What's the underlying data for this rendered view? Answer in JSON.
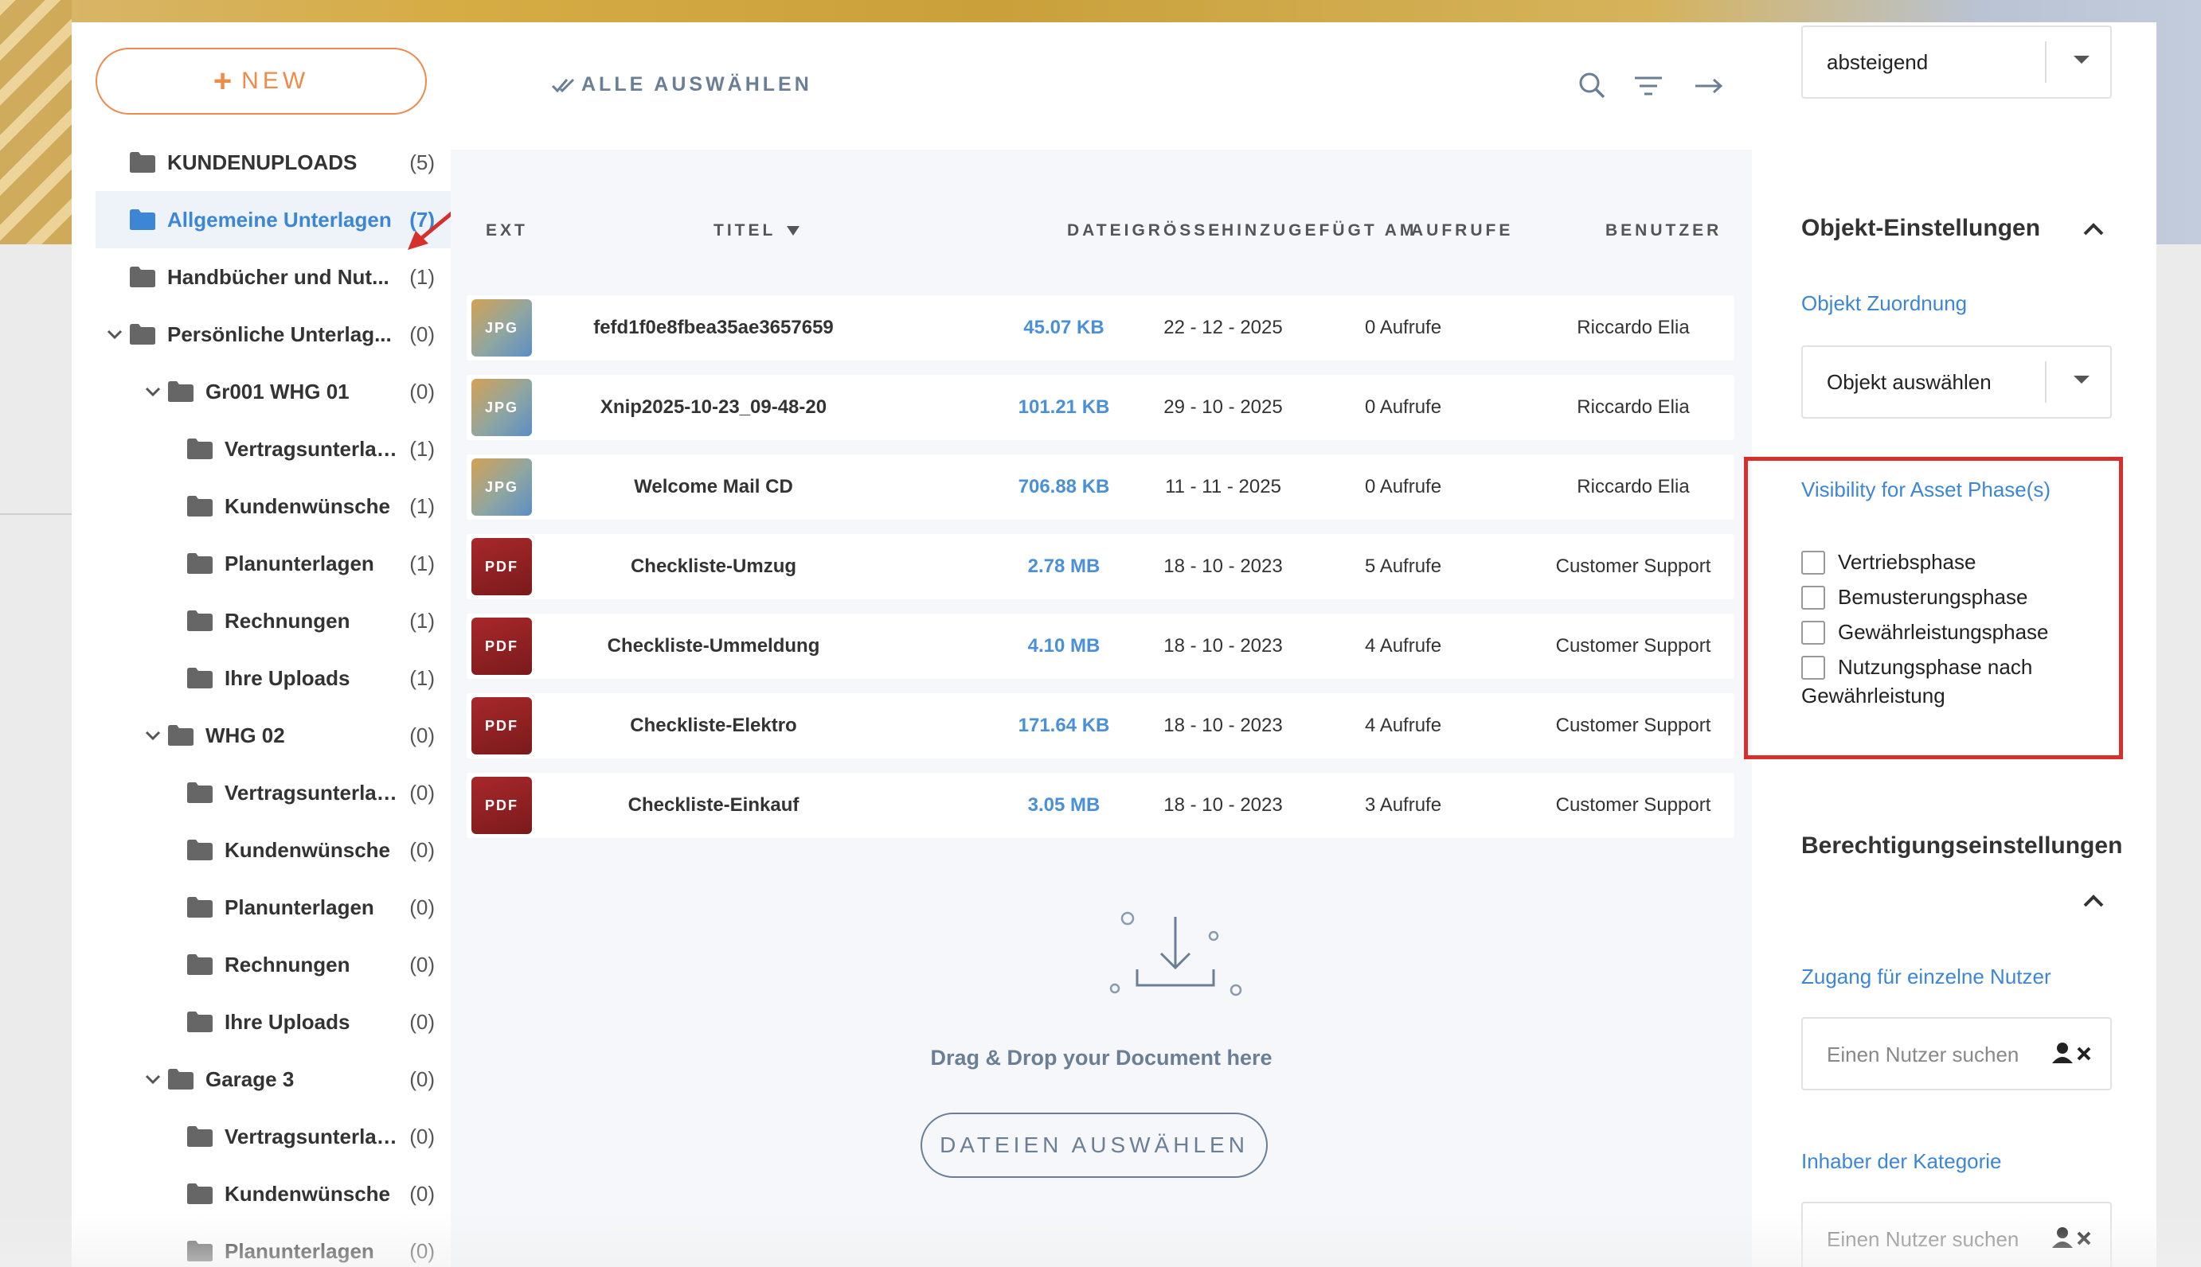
{
  "sidebar": {
    "new_label": "NEW",
    "items": [
      {
        "label": "KUNDENUPLOADS",
        "count": "(5)"
      },
      {
        "label": "Allgemeine Unterlagen",
        "count": "(7)"
      },
      {
        "label": "Handbücher und Nut...",
        "count": "(1)"
      },
      {
        "label": "Persönliche Unterlag...",
        "count": "(0)"
      },
      {
        "label": "Gr001 WHG 01",
        "count": "(0)"
      },
      {
        "label": "Vertragsunterlag...",
        "count": "(1)"
      },
      {
        "label": "Kundenwünsche",
        "count": "(1)"
      },
      {
        "label": "Planunterlagen",
        "count": "(1)"
      },
      {
        "label": "Rechnungen",
        "count": "(1)"
      },
      {
        "label": "Ihre Uploads",
        "count": "(1)"
      },
      {
        "label": "WHG 02",
        "count": "(0)"
      },
      {
        "label": "Vertragsunterlag...",
        "count": "(0)"
      },
      {
        "label": "Kundenwünsche",
        "count": "(0)"
      },
      {
        "label": "Planunterlagen",
        "count": "(0)"
      },
      {
        "label": "Rechnungen",
        "count": "(0)"
      },
      {
        "label": "Ihre Uploads",
        "count": "(0)"
      },
      {
        "label": "Garage 3",
        "count": "(0)"
      },
      {
        "label": "Vertragsunterlag...",
        "count": "(0)"
      },
      {
        "label": "Kundenwünsche",
        "count": "(0)"
      },
      {
        "label": "Planunterlagen",
        "count": "(0)"
      }
    ]
  },
  "toolbar": {
    "select_all": "ALLE AUSWÄHLEN"
  },
  "table": {
    "headers": {
      "ext": "EXT",
      "title": "TITEL",
      "size": "DATEIGRÖSSE",
      "added": "HINZUGEFÜGT AM",
      "views": "AUFRUFE",
      "user": "BENUTZER"
    },
    "rows": [
      {
        "ext": "JPG",
        "title": "fefd1f0e8fbea35ae3657659",
        "size": "45.07 KB",
        "added": "22 - 12 - 2025",
        "views": "0 Aufrufe",
        "user": "Riccardo Elia"
      },
      {
        "ext": "JPG",
        "title": "Xnip2025-10-23_09-48-20",
        "size": "101.21 KB",
        "added": "29 - 10 - 2025",
        "views": "0 Aufrufe",
        "user": "Riccardo Elia"
      },
      {
        "ext": "JPG",
        "title": "Welcome Mail CD",
        "size": "706.88 KB",
        "added": "11 - 11 - 2025",
        "views": "0 Aufrufe",
        "user": "Riccardo Elia"
      },
      {
        "ext": "PDF",
        "title": "Checkliste-Umzug",
        "size": "2.78 MB",
        "added": "18 - 10 - 2023",
        "views": "5 Aufrufe",
        "user": "Customer Support"
      },
      {
        "ext": "PDF",
        "title": "Checkliste-Ummeldung",
        "size": "4.10 MB",
        "added": "18 - 10 - 2023",
        "views": "4 Aufrufe",
        "user": "Customer Support"
      },
      {
        "ext": "PDF",
        "title": "Checkliste-Elektro",
        "size": "171.64 KB",
        "added": "18 - 10 - 2023",
        "views": "4 Aufrufe",
        "user": "Customer Support"
      },
      {
        "ext": "PDF",
        "title": "Checkliste-Einkauf",
        "size": "3.05 MB",
        "added": "18 - 10 - 2023",
        "views": "3 Aufrufe",
        "user": "Customer Support"
      }
    ]
  },
  "dropzone": {
    "text": "Drag & Drop your Document here",
    "button": "DATEIEN AUSWÄHLEN"
  },
  "right": {
    "sort_value": "absteigend",
    "object_settings_title": "Objekt-Einstellungen",
    "object_assign_label": "Objekt Zuordnung",
    "object_select_value": "Objekt auswählen",
    "visibility_label": "Visibility for Asset Phase(s)",
    "phases": [
      "Vertriebsphase",
      "Bemusterungsphase",
      "Gewährleistungsphase",
      "Nutzungsphase nach",
      "Gewährleistung"
    ],
    "permission_title": "Berechtigungseinstellungen",
    "single_user_label": "Zugang für einzelne Nutzer",
    "user_search_placeholder": "Einen Nutzer suchen",
    "owner_label": "Inhaber der Kategorie",
    "owner_search_placeholder": "Einen Nutzer suchen"
  },
  "colors": {
    "accent_orange": "#ee8a4a",
    "link_blue": "#3d86d6",
    "size_blue": "#4a90d9",
    "highlight_red": "#d6302c",
    "pdf_red": "#a8282a"
  }
}
